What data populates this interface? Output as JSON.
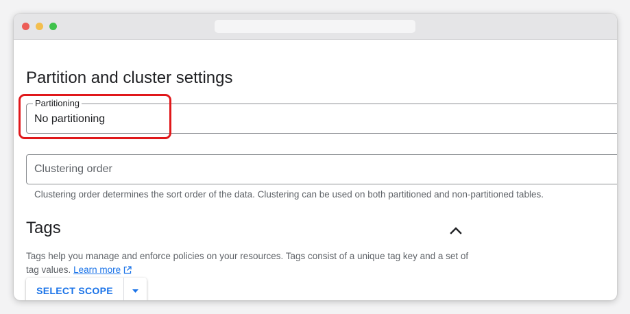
{
  "partition_section": {
    "title": "Partition and cluster settings",
    "partitioning": {
      "label": "Partitioning",
      "value": "No partitioning"
    },
    "clustering": {
      "placeholder": "Clustering order",
      "hint": "Clustering order determines the sort order of the data. Clustering can be used on both partitioned and non-partitioned tables."
    }
  },
  "tags_section": {
    "title": "Tags",
    "description": "Tags help you manage and enforce policies on your resources. Tags consist of a unique tag key and a set of tag values.",
    "learn_more": "Learn more",
    "select_scope_label": "SELECT SCOPE"
  },
  "colors": {
    "accent": "#1a73e8",
    "highlight": "#e0181b"
  },
  "icons": {
    "collapse": "chevron-up-icon",
    "external": "external-link-icon",
    "dropdown": "caret-down-icon"
  }
}
